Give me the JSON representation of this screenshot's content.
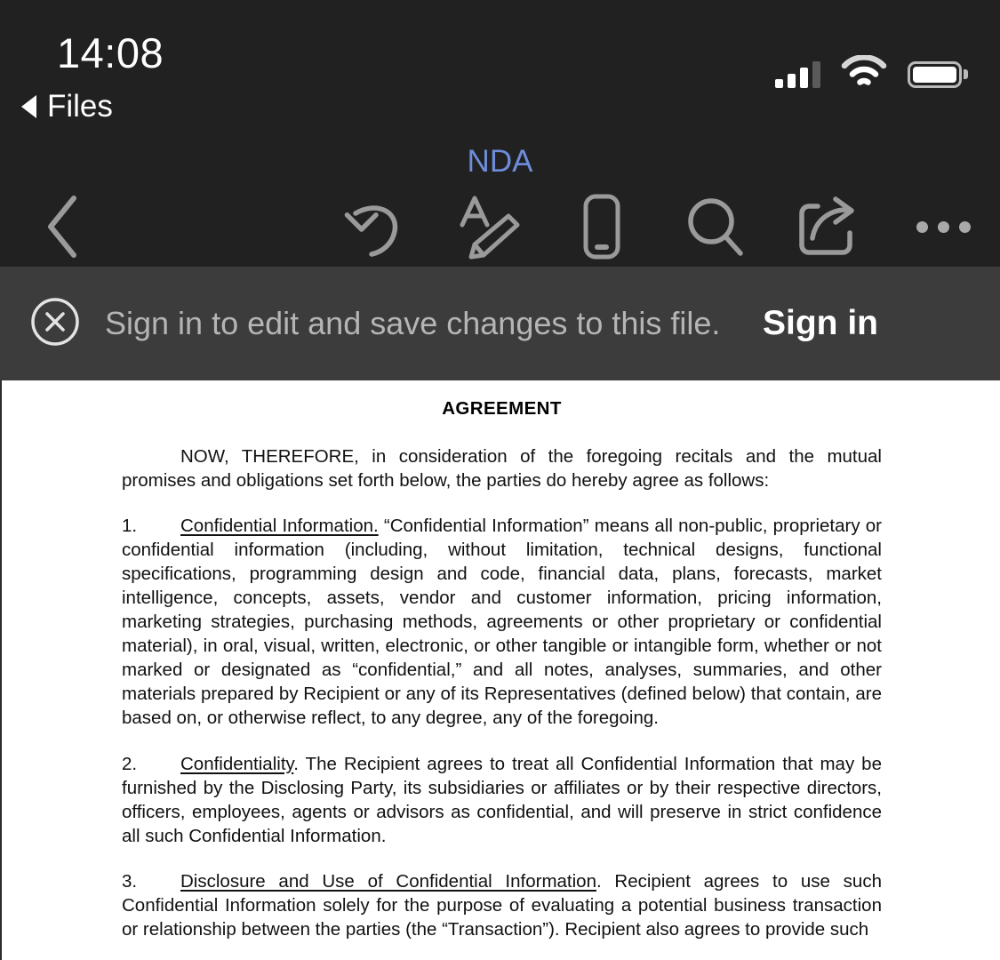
{
  "status_bar": {
    "time": "14:08",
    "back_label": "Files",
    "icons": {
      "signal": "signal-bars-icon",
      "wifi": "wifi-icon",
      "battery": "battery-icon"
    },
    "signal_bars_filled": 3,
    "signal_bars_total": 4
  },
  "toolbar": {
    "document_title": "NDA",
    "title_color": "#6e8cdb",
    "items": [
      {
        "name": "back-button",
        "icon": "chevron-left-icon"
      },
      {
        "name": "undo-button",
        "icon": "undo-arrow-icon"
      },
      {
        "name": "markup-button",
        "icon": "text-pen-icon"
      },
      {
        "name": "mobile-view-button",
        "icon": "phone-icon"
      },
      {
        "name": "search-button",
        "icon": "search-icon"
      },
      {
        "name": "share-button",
        "icon": "share-icon"
      },
      {
        "name": "more-button",
        "icon": "ellipsis-icon"
      }
    ]
  },
  "banner": {
    "message": "Sign in to edit and save changes to this file.",
    "sign_in_label": "Sign in",
    "close_icon": "close-circle-icon",
    "background": "#3c3c3c"
  },
  "document": {
    "heading": "AGREEMENT",
    "paragraphs": [
      {
        "kind": "intro",
        "text": "NOW, THEREFORE, in consideration of the foregoing recitals and the mutual promises and obligations set forth below, the parties do hereby agree as follows:"
      },
      {
        "kind": "clause",
        "number": "1.",
        "title": "Confidential Information.",
        "text": " “Confidential Information” means all non-public, proprietary or confidential information (including, without limitation, technical designs, functional specifications, programming design and code, financial data, plans, forecasts, market intelligence, concepts, assets, vendor and customer information, pricing information, marketing strategies, purchasing methods, agreements or other proprietary or confidential material), in oral, visual, written, electronic, or other tangible or intangible form, whether or not marked or designated as “confidential,” and all notes, analyses, summaries, and other materials prepared by Recipient or any of its Representatives (defined below) that contain, are based on, or otherwise reflect, to any degree, any of the foregoing."
      },
      {
        "kind": "clause",
        "number": "2.",
        "title": "Confidentiality",
        "text": ". The Recipient agrees to treat all Confidential Information that may be furnished by the Disclosing Party, its subsidiaries or affiliates or by their respective directors, officers, employees, agents or advisors as confidential, and will preserve in strict confidence all such Confidential Information."
      },
      {
        "kind": "clause",
        "number": "3.",
        "title": "Disclosure and Use of Confidential Information",
        "text": ". Recipient agrees to use such Confidential Information solely for the purpose of evaluating a potential business transaction or relationship between the parties (the “Transaction”).   Recipient also agrees to provide such"
      }
    ]
  }
}
